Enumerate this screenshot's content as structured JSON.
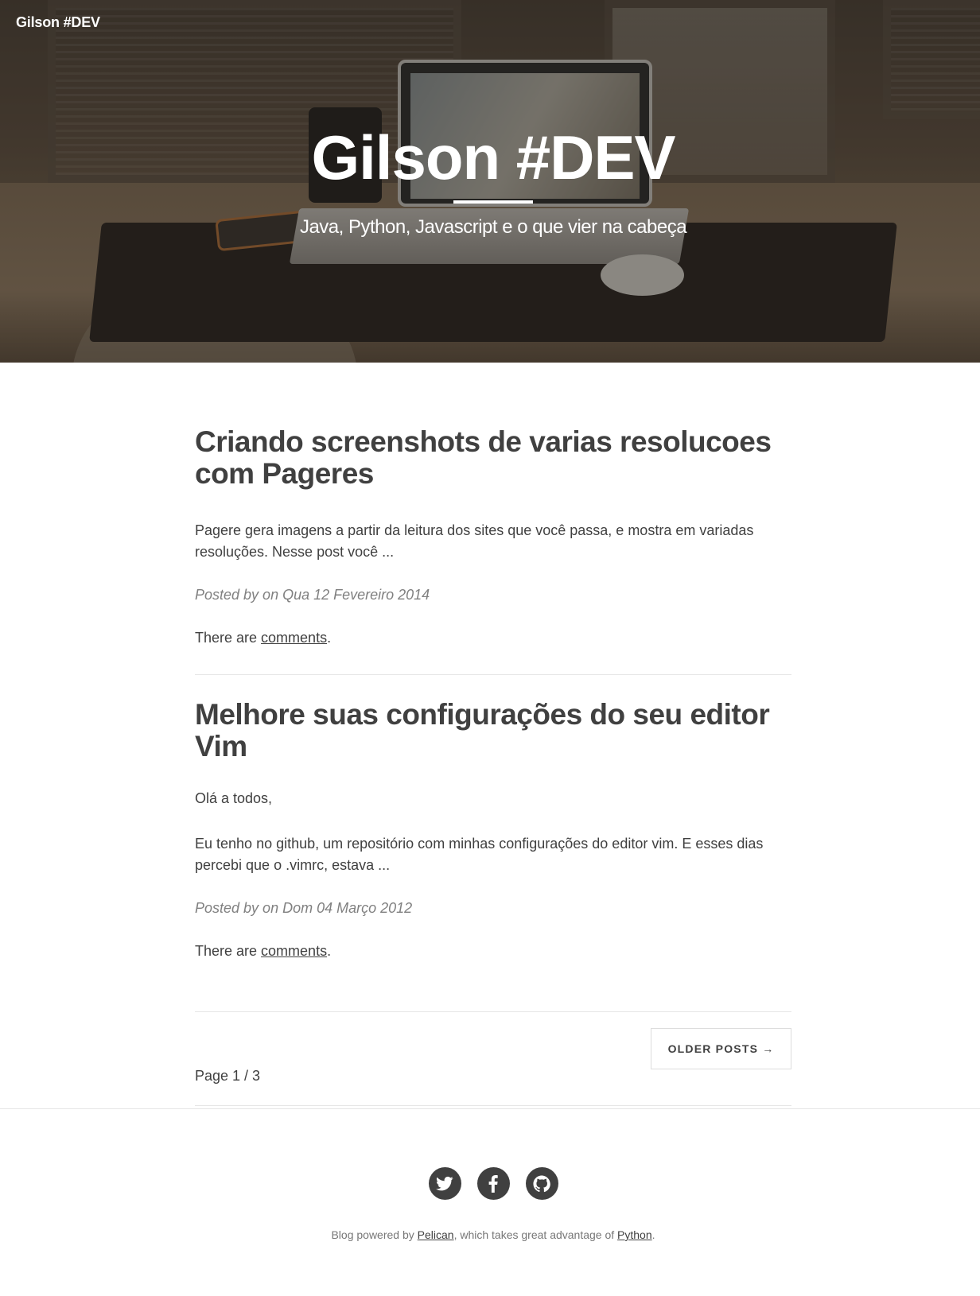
{
  "navbar": {
    "brand": "Gilson #DEV"
  },
  "hero": {
    "title": "Gilson #DEV",
    "subtitle": "Java, Python, Javascript e o que vier na cabeça"
  },
  "posts": [
    {
      "title": "Criando screenshots de varias resolucoes com Pageres",
      "summary": "Pagere gera imagens a partir da leitura dos sites que você passa, e mostra em variadas resoluções. Nesse post você ...",
      "meta": "Posted by on Qua 12 Fevereiro 2014",
      "comments_prefix": "There are ",
      "comments_link": "comments",
      "comments_suffix": "."
    },
    {
      "title": "Melhore suas configurações do seu editor Vim",
      "summary_1": "Olá a todos,",
      "summary_2": "Eu tenho no github, um repositório com minhas configurações do editor vim. E esses dias percebi que o .vimrc, estava ...",
      "meta": "Posted by on Dom 04 Março 2012",
      "comments_prefix": "There are ",
      "comments_link": "comments",
      "comments_suffix": "."
    }
  ],
  "pagination": {
    "older_label": "OLDER POSTS →",
    "page_info": "Page 1 / 3"
  },
  "footer": {
    "social": [
      "twitter-icon",
      "facebook-icon",
      "github-icon"
    ],
    "text_1": "Blog powered by ",
    "link_1": "Pelican",
    "text_2": ", which takes great advantage of ",
    "link_2": "Python",
    "text_3": "."
  }
}
